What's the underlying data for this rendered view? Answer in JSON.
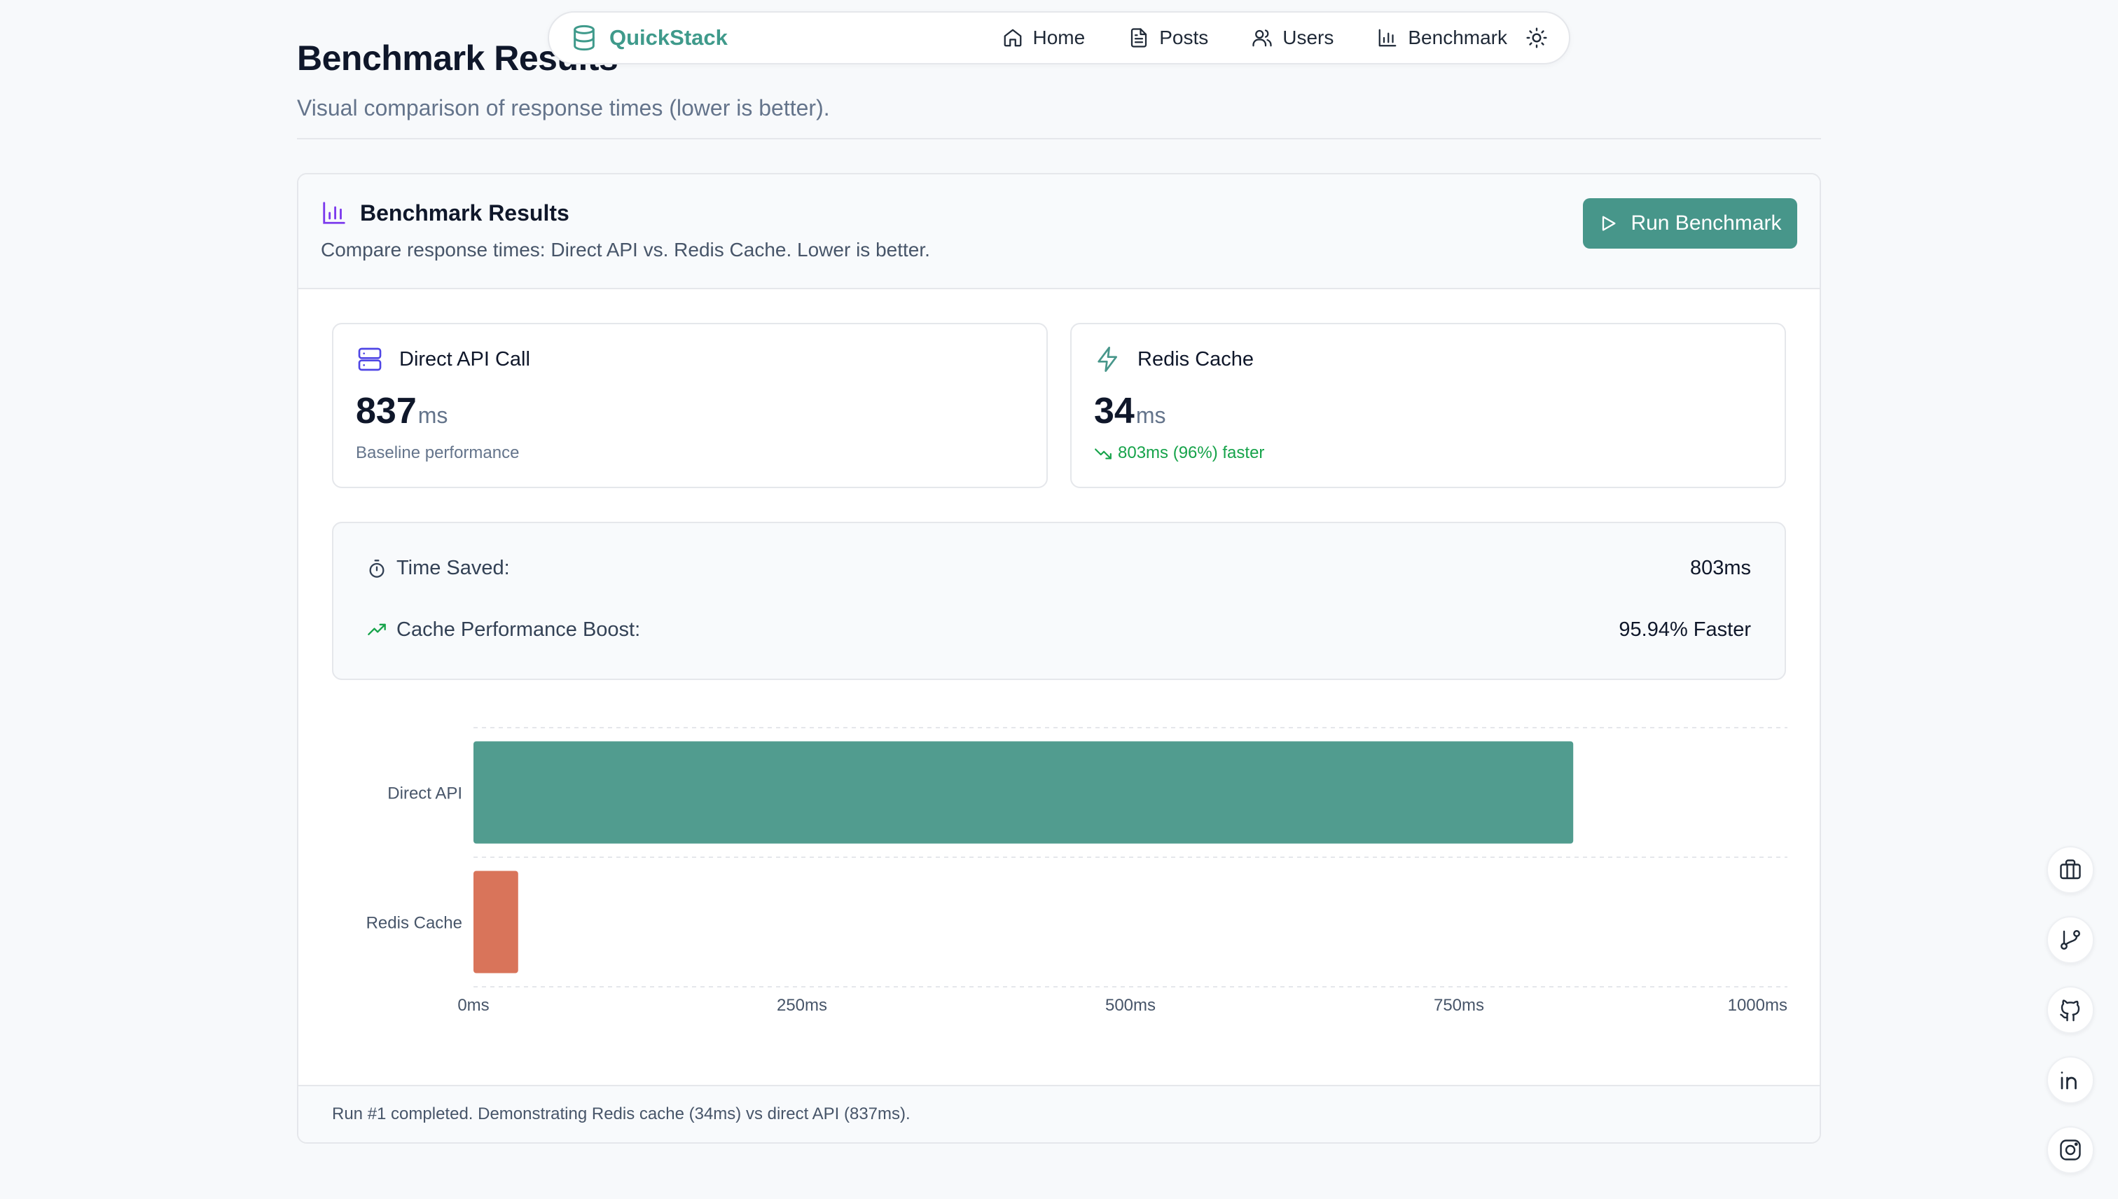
{
  "nav": {
    "brand": "QuickStack",
    "links": [
      {
        "label": "Home",
        "icon": "home-icon"
      },
      {
        "label": "Posts",
        "icon": "file-text-icon"
      },
      {
        "label": "Users",
        "icon": "users-icon"
      },
      {
        "label": "Benchmark",
        "icon": "bar-chart-icon"
      }
    ],
    "theme_icon": "sun-icon"
  },
  "page": {
    "title": "Benchmark Results",
    "subtitle": "Visual comparison of response times (lower is better)."
  },
  "card": {
    "title": "Benchmark Results",
    "description": "Compare response times: Direct API vs. Redis Cache. Lower is better.",
    "run_button": "Run Benchmark",
    "metrics": [
      {
        "label": "Direct API Call",
        "value": "837",
        "unit": "ms",
        "note": "Baseline performance",
        "icon": "server-icon"
      },
      {
        "label": "Redis Cache",
        "value": "34",
        "unit": "ms",
        "note": "803ms (96%) faster",
        "icon": "zap-icon"
      }
    ],
    "summary": [
      {
        "label": "Time Saved:",
        "value": "803ms",
        "icon": "timer-icon"
      },
      {
        "label": "Cache Performance Boost:",
        "value": "95.94% Faster",
        "icon": "trending-up-icon"
      }
    ],
    "footer": "Run #1 completed. Demonstrating Redis cache (34ms) vs direct API (837ms)."
  },
  "chart_data": {
    "type": "bar",
    "orientation": "horizontal",
    "categories": [
      "Direct API",
      "Redis Cache"
    ],
    "values": [
      837,
      34
    ],
    "colors": [
      "#519c8f",
      "#d9745a"
    ],
    "xlim": [
      0,
      1000
    ],
    "xticks": [
      "0ms",
      "250ms",
      "500ms",
      "750ms",
      "1000ms"
    ],
    "tick_values": [
      0,
      250,
      500,
      750,
      1000
    ],
    "grid": true
  },
  "social": [
    "briefcase-icon",
    "git-branch-icon",
    "github-icon",
    "linkedin-icon",
    "instagram-icon"
  ],
  "colors": {
    "accent": "#47968a",
    "brand": "#3f9a8b",
    "good": "#16a34a",
    "icon_purple": "#7c3aed",
    "icon_indigo": "#4f46e5"
  }
}
